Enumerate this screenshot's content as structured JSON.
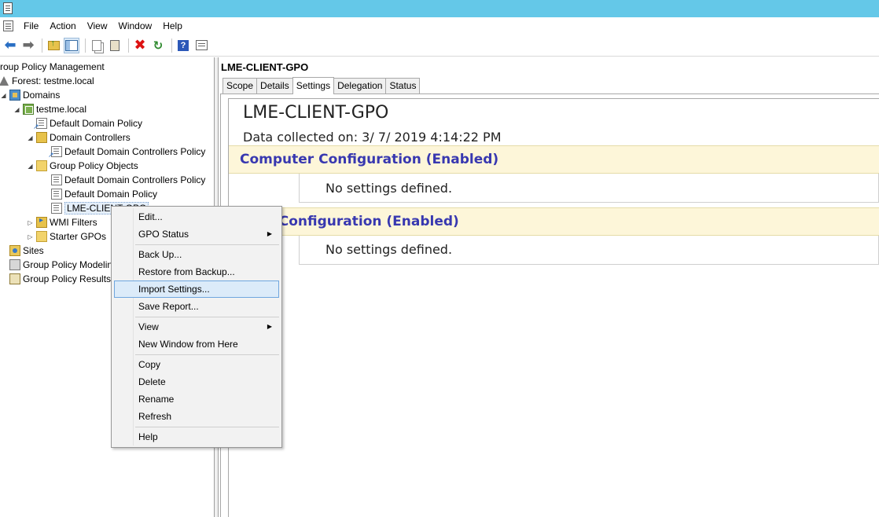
{
  "menubar": {
    "items": [
      "File",
      "Action",
      "View",
      "Window",
      "Help"
    ]
  },
  "toolbar": {
    "icons": [
      "back-icon",
      "forward-icon",
      "up-folder-icon",
      "show-hide-tree-icon",
      "copy-icon",
      "paste-icon",
      "delete-icon",
      "refresh-icon",
      "help-icon",
      "properties-icon"
    ]
  },
  "tree": {
    "root": "roup Policy Management",
    "forest": "Forest: testme.local",
    "domains": "Domains",
    "domain": "testme.local",
    "default_domain_policy": "Default Domain Policy",
    "domain_controllers": "Domain Controllers",
    "dc_policy_link": "Default Domain Controllers Policy",
    "gpo_folder": "Group Policy Objects",
    "gpo_dc_policy": "Default Domain Controllers Policy",
    "gpo_default_domain_policy": "Default Domain Policy",
    "gpo_lme": "LME-CLIENT-GPO",
    "wmi_filters": "WMI Filters",
    "starter_gpos": "Starter GPOs",
    "sites": "Sites",
    "modeling": "Group Policy Modeling",
    "results": "Group Policy Results"
  },
  "right_pane": {
    "title": "LME-CLIENT-GPO",
    "tabs": [
      "Scope",
      "Details",
      "Settings",
      "Delegation",
      "Status"
    ],
    "active_tab": "Settings",
    "report": {
      "title": "LME-CLIENT-GPO",
      "date": "Data collected on: 3/ 7/ 2019 4:14:22 PM",
      "computer_section": "Computer Configuration (Enabled)",
      "computer_nosettings": "No settings defined.",
      "user_section": "User Configuration (Enabled)",
      "user_nosettings": "No settings defined."
    }
  },
  "context_menu": {
    "items": [
      "Edit...",
      "GPO Status",
      "Back Up...",
      "Restore from Backup...",
      "Import Settings...",
      "Save Report...",
      "View",
      "New Window from Here",
      "Copy",
      "Delete",
      "Rename",
      "Refresh",
      "Help"
    ],
    "highlighted": "Import Settings..."
  },
  "colors": {
    "titlebar": "#64c8e8",
    "section_bar": "#fdf6d9",
    "section_text": "#3838b0",
    "menu_highlight": "#dcebf9"
  }
}
